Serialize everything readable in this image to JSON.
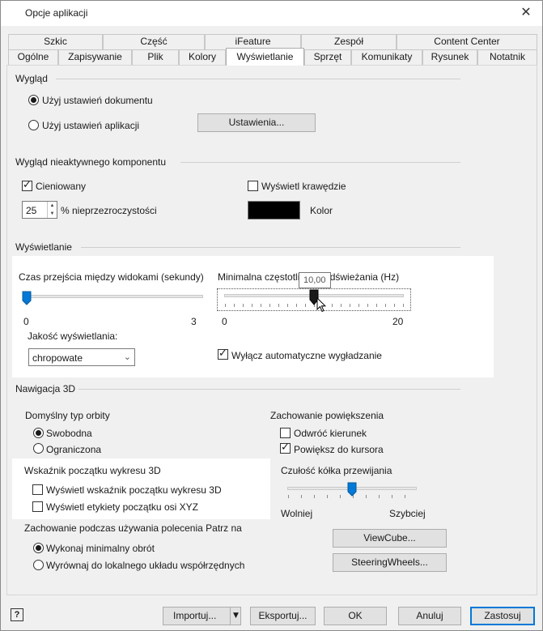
{
  "window": {
    "title": "Opcje aplikacji",
    "close_icon": "close-icon"
  },
  "tabs": {
    "row1": [
      "Szkic",
      "Część",
      "iFeature",
      "Zespół",
      "Content Center"
    ],
    "row2": [
      "Ogólne",
      "Zapisywanie",
      "Plik",
      "Kolory",
      "Wyświetlanie",
      "Sprzęt",
      "Komunikaty",
      "Rysunek",
      "Notatnik"
    ],
    "active": "Wyświetlanie"
  },
  "wyglad": {
    "legend": "Wygląd",
    "radio_document": "Użyj ustawień dokumentu",
    "radio_app": "Użyj ustawień aplikacji",
    "settings_button": "Ustawienia...",
    "selected": "document"
  },
  "inactive": {
    "legend": "Wygląd nieaktywnego komponentu",
    "shaded_label": "Cieniowany",
    "shaded_checked": true,
    "opacity_value": "25",
    "opacity_label": "% nieprzezroczystości",
    "edges_label": "Wyświetl krawędzie",
    "edges_checked": false,
    "color_label": "Kolor",
    "color": "#000000"
  },
  "display": {
    "legend": "Wyświetlanie",
    "transition_label": "Czas przejścia między widokami (sekundy)",
    "transition_min": "0",
    "transition_max": "3",
    "transition_value": 0,
    "framerate_label": "Minimalna częstotliwość odświeżania (Hz)",
    "framerate_min": "0",
    "framerate_max": "20",
    "framerate_value": 10,
    "framerate_tooltip": "10,00",
    "quality_label": "Jakość wyświetlania:",
    "quality_value": "chropowate",
    "smoothing_label": "Wyłącz automatyczne wygładzanie",
    "smoothing_checked": true
  },
  "nav3d": {
    "legend": "Nawigacja 3D",
    "orbit_label": "Domyślny typ orbity",
    "orbit_free": "Swobodna",
    "orbit_constrained": "Ograniczona",
    "orbit_selected": "free",
    "zoom_label": "Zachowanie powiększenia",
    "zoom_reverse": "Odwróć kierunek",
    "zoom_reverse_checked": false,
    "zoom_cursor": "Powiększ do kursora",
    "zoom_cursor_checked": true,
    "origin_label": "Wskaźnik początku wykresu 3D",
    "origin_indicator": "Wyświetl wskaźnik początku wykresu 3D",
    "origin_indicator_checked": false,
    "origin_labels": "Wyświetl etykiety początku osi XYZ",
    "origin_labels_checked": false,
    "wheel_label": "Czułość kółka przewijania",
    "wheel_slow": "Wolniej",
    "wheel_fast": "Szybciej",
    "wheel_value": 0.5,
    "look_label": "Zachowanie podczas używania polecenia Patrz na",
    "look_min_rotation": "Wykonaj minimalny obrót",
    "look_align_ucs": "Wyrównaj do lokalnego układu współrzędnych",
    "look_selected": "min_rotation",
    "viewcube_button": "ViewCube...",
    "steeringwheels_button": "SteeringWheels..."
  },
  "footer": {
    "help": "?",
    "import": "Importuj...",
    "export": "Eksportuj...",
    "ok": "OK",
    "cancel": "Anuluj",
    "apply": "Zastosuj"
  }
}
